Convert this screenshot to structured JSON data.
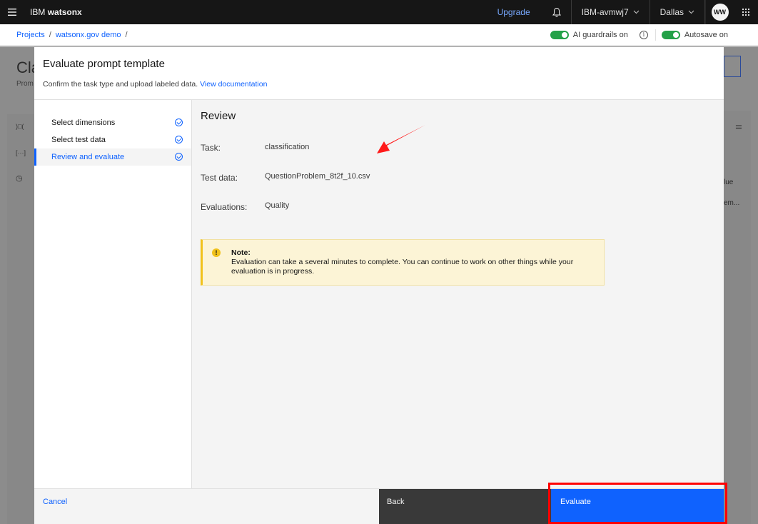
{
  "header": {
    "brand_prefix": "IBM",
    "brand_name": "watsonx",
    "upgrade_label": "Upgrade",
    "account": "IBM-avmwj7",
    "region": "Dallas",
    "avatar_initials": "WW",
    "icons": [
      "menu-icon",
      "bell-icon",
      "chevron-down-icon",
      "app-switcher-icon"
    ]
  },
  "breadcrumb": {
    "items": [
      "Projects",
      "watsonx.gov demo"
    ],
    "separator": "/"
  },
  "toggles": {
    "guardrails_label": "AI guardrails on",
    "autosave_label": "Autosave on"
  },
  "background_page": {
    "title_fragment": "Cla",
    "subtitle_fragment": "Prom",
    "column_fragment": "lue",
    "cell_fragment": "em..."
  },
  "modal": {
    "title": "Evaluate prompt template",
    "description": "Confirm the task type and upload labeled data.",
    "doc_link": "View documentation",
    "steps": [
      {
        "label": "Select dimensions",
        "status": "complete"
      },
      {
        "label": "Select test data",
        "status": "complete"
      },
      {
        "label": "Review and evaluate",
        "status": "complete",
        "active": true
      }
    ],
    "review": {
      "title": "Review",
      "rows": [
        {
          "label": "Task:",
          "value": "classification"
        },
        {
          "label": "Test data:",
          "value": "QuestionProblem_8t2f_10.csv"
        },
        {
          "label": "Evaluations:",
          "value": "Quality"
        }
      ]
    },
    "note": {
      "title": "Note:",
      "body": "Evaluation can take a several minutes to complete. You can continue to work on other things while your evaluation is in progress."
    },
    "footer": {
      "cancel_label": "Cancel",
      "back_label": "Back",
      "evaluate_label": "Evaluate"
    }
  },
  "colors": {
    "primary": "#0f62fe",
    "header_bg": "#161616",
    "toggle_on": "#24a148",
    "warning": "#f1c21b",
    "annotation": "#ff0000"
  }
}
